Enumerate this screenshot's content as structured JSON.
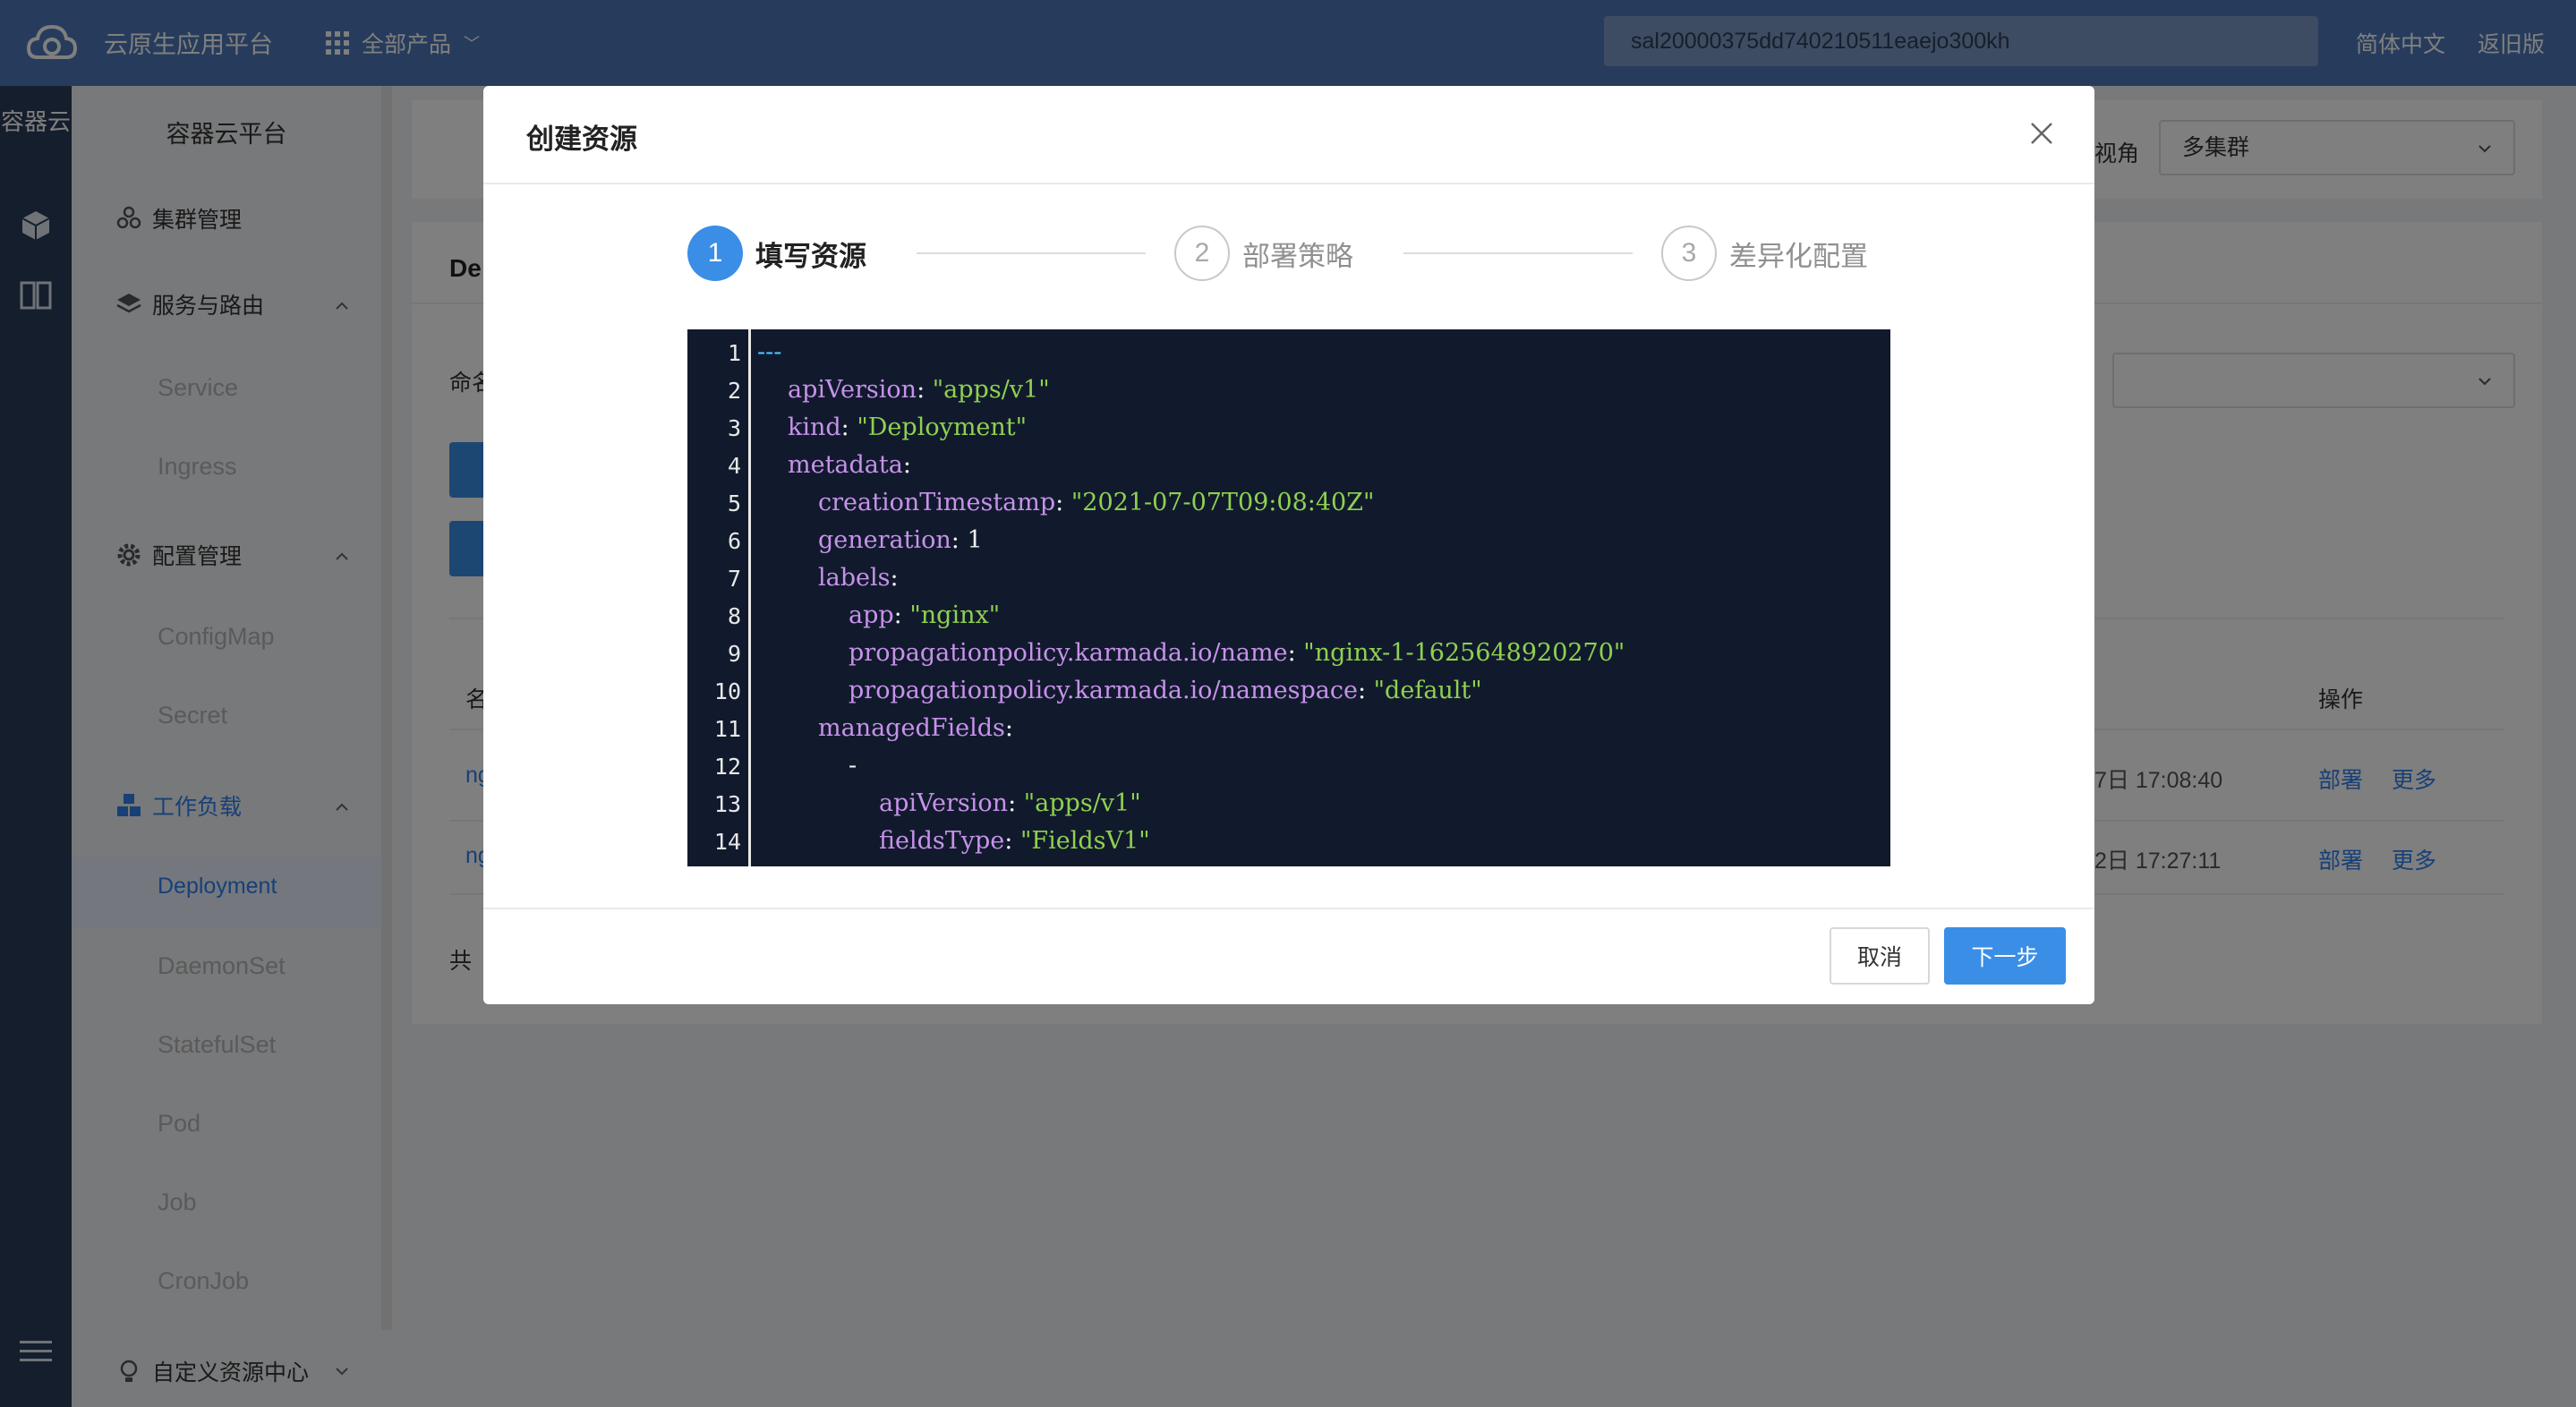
{
  "header": {
    "brand": "云原生应用平台",
    "all_products": "全部产品",
    "account": "sal20000375dd740210511eaejo300kh",
    "language": "简体中文",
    "old_version": "返旧版"
  },
  "rail": {
    "title": "容器云"
  },
  "sidebar": {
    "title": "容器云平台",
    "cluster": "集群管理",
    "services": "服务与路由",
    "service": "Service",
    "ingress": "Ingress",
    "config": "配置管理",
    "configmap": "ConfigMap",
    "secret": "Secret",
    "workload": "工作负载",
    "deployment": "Deployment",
    "daemonset": "DaemonSet",
    "statefulset": "StatefulSet",
    "pod": "Pod",
    "job": "Job",
    "cronjob": "CronJob",
    "crd": "自定义资源中心"
  },
  "background": {
    "view_label": "视角",
    "view_value": "多集群",
    "page_title": "De",
    "namespace_label": "命名",
    "col_name": "名",
    "col_action": "操作",
    "rows": [
      {
        "name": "ng",
        "time": "7日 17:08:40",
        "deploy": "部署",
        "more": "更多"
      },
      {
        "name": "ng",
        "time": "2日 17:27:11",
        "deploy": "部署",
        "more": "更多"
      }
    ],
    "total": "共"
  },
  "modal": {
    "title": "创建资源",
    "steps": [
      {
        "num": "1",
        "label": "填写资源"
      },
      {
        "num": "2",
        "label": "部署策略"
      },
      {
        "num": "3",
        "label": "差异化配置"
      }
    ],
    "code_lines": [
      {
        "n": "1"
      },
      {
        "n": "2"
      },
      {
        "n": "3"
      },
      {
        "n": "4"
      },
      {
        "n": "5"
      },
      {
        "n": "6"
      },
      {
        "n": "7"
      },
      {
        "n": "8"
      },
      {
        "n": "9"
      },
      {
        "n": "10"
      },
      {
        "n": "11"
      },
      {
        "n": "12"
      },
      {
        "n": "13"
      },
      {
        "n": "14"
      }
    ],
    "code": {
      "l1": "---",
      "l2k": "apiVersion",
      "l2v": "\"apps/v1\"",
      "l3k": "kind",
      "l3v": "\"Deployment\"",
      "l4k": "metadata",
      "l5k": "creationTimestamp",
      "l5v": "\"2021-07-07T09:08:40Z\"",
      "l6k": "generation",
      "l6v": "1",
      "l7k": "labels",
      "l8k": "app",
      "l8v": "\"nginx\"",
      "l9k": "propagationpolicy.karmada.io/name",
      "l9v": "\"nginx-1-1625648920270\"",
      "l10k": "propagationpolicy.karmada.io/namespace",
      "l10v": "\"default\"",
      "l11k": "managedFields",
      "l12": "-",
      "l13k": "apiVersion",
      "l13v": "\"apps/v1\"",
      "l14k": "fieldsType",
      "l14v": "\"FieldsV1\""
    },
    "cancel": "取消",
    "next": "下一步"
  }
}
